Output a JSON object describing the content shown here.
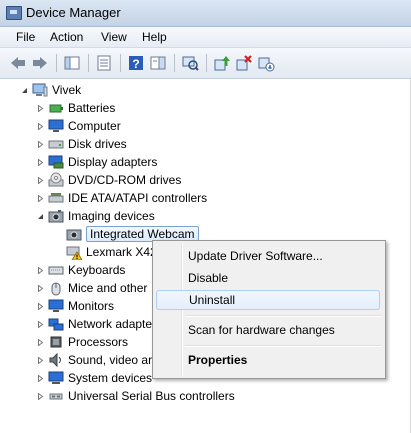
{
  "window": {
    "title": "Device Manager"
  },
  "menu": [
    "File",
    "Action",
    "View",
    "Help"
  ],
  "toolbar": [
    {
      "name": "back-arrow-icon"
    },
    {
      "name": "forward-arrow-icon"
    },
    {
      "name": "show-hide-tree-icon"
    },
    {
      "name": "properties-icon"
    },
    {
      "name": "help-icon"
    },
    {
      "name": "action-pane-icon"
    },
    {
      "name": "scan-hardware-icon"
    },
    {
      "name": "update-driver-icon"
    },
    {
      "name": "uninstall-icon"
    },
    {
      "name": "disable-icon"
    }
  ],
  "tree": {
    "root": "Vivek",
    "items": [
      "Batteries",
      "Computer",
      "Disk drives",
      "Display adapters",
      "DVD/CD-ROM drives",
      "IDE ATA/ATAPI controllers",
      "Imaging devices",
      "Integrated Webcam",
      "Lexmark X42",
      "Keyboards",
      "Mice and other",
      "Monitors",
      "Network adapte",
      "Processors",
      "Sound, video ar",
      "System devices",
      "Universal Serial Bus controllers"
    ]
  },
  "context_menu": {
    "update": "Update Driver Software...",
    "disable": "Disable",
    "uninstall": "Uninstall",
    "scan": "Scan for hardware changes",
    "properties": "Properties"
  }
}
